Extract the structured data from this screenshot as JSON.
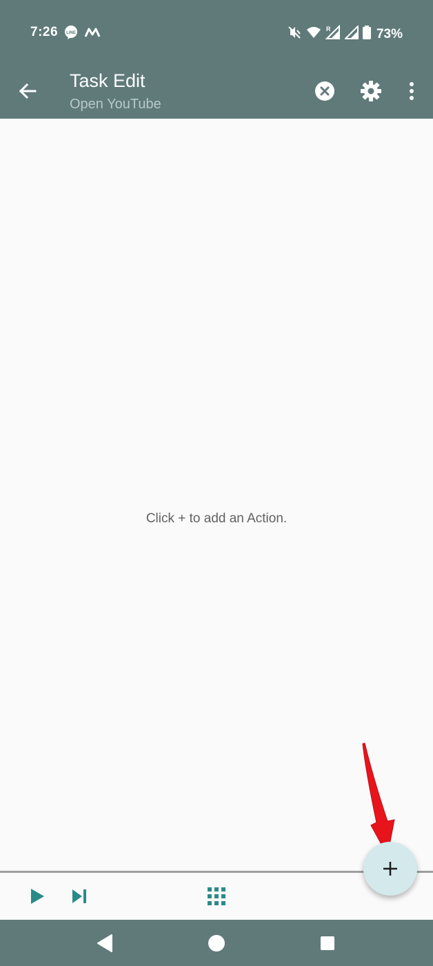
{
  "status_bar": {
    "time": "7:26",
    "battery": "73%",
    "icons": [
      "line-app-icon",
      "m-app-icon",
      "vibrate-off-icon",
      "wifi-icon",
      "signal-roaming-icon",
      "signal-icon",
      "battery-icon"
    ],
    "roaming_marker": "R"
  },
  "app_bar": {
    "title": "Task Edit",
    "subtitle": "Open YouTube",
    "icons": [
      "back-arrow-icon",
      "clear-circle-icon",
      "gear-icon",
      "more-vertical-icon"
    ]
  },
  "content": {
    "empty_message": "Click + to add an Action."
  },
  "bottom_bar": {
    "icons": [
      "play-icon",
      "skip-next-icon",
      "apps-grid-icon"
    ]
  },
  "fab": {
    "label": "+"
  },
  "nav_bar": {
    "icons": [
      "nav-back-icon",
      "nav-home-icon",
      "nav-recents-icon"
    ]
  },
  "colors": {
    "bar": "#607a7a",
    "accent": "#2a8a8a",
    "fab": "#d4e9ec",
    "annotation_arrow": "#e8141c"
  }
}
